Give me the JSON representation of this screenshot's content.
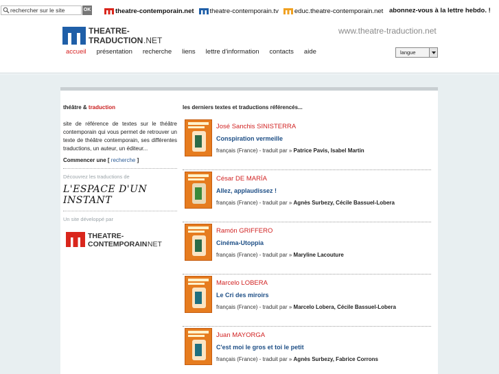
{
  "topbar": {
    "search_placeholder": "rechercher sur le site",
    "ok_label": "OK",
    "links": [
      {
        "label": "theatre-contemporain.net",
        "bold": true
      },
      {
        "label": "theatre-contemporain.tv",
        "bold": false
      },
      {
        "label": "educ.theatre-contemporain.net",
        "bold": false
      }
    ],
    "newsletter": "abonnez-vous à la lettre hebdo. !"
  },
  "header": {
    "logo_line1": "THEATRE-",
    "logo_line2": "TRADUCTION",
    "logo_suffix": ".NET",
    "site_url": "www.theatre-traduction.net",
    "nav": [
      "accueil",
      "présentation",
      "recherche",
      "liens",
      "lettre d'information",
      "contacts",
      "aide"
    ],
    "active_nav": "accueil",
    "lang_label": "langue"
  },
  "left": {
    "heading_part1": "théâtre & ",
    "heading_part2": "traduction",
    "description": "site de référence de textes sur le théâtre contemporain qui vous permet de retrouver un texte de théâtre contemporain, ses différentes traductions, un auteur, un éditeur...",
    "cta_text": "Commencer une [ ",
    "cta_link": "recherche",
    "cta_end": " ]",
    "discover_label": "Découvrez les traductions de",
    "espace_logo": "L'ESPACE D'UN INSTANT",
    "developed_label": "Un site développé par",
    "tc_logo_line1": "THEATRE-",
    "tc_logo_line2": "CONTEMPORAIN",
    "tc_logo_suffix": ".NET"
  },
  "right": {
    "heading": "les derniers textes et traductions référencés...",
    "traduit_par": "traduit par »",
    "entries": [
      {
        "author": "José Sanchis SINISTERRA",
        "title": "Conspiration vermeille",
        "lang": "français (France) -",
        "translators": "Patrice Pavis, Isabel Martin"
      },
      {
        "author": "César DE MARÍA",
        "title": "Allez, applaudissez !",
        "lang": "français (France) -",
        "translators": "Agnès Surbezy, Cécile Bassuel-Lobera"
      },
      {
        "author": "Ramón GRIFFERO",
        "title": "Cinéma-Utoppia",
        "lang": "français (France) -",
        "translators": "Maryline Lacouture"
      },
      {
        "author": "Marcelo LOBERA",
        "title": "Le Cri des miroirs",
        "lang": "français (France) -",
        "translators": "Marcelo Lobera, Cécile Bassuel-Lobera"
      },
      {
        "author": "Juan MAYORGA",
        "title": "C'est moi le gros et toi le petit",
        "lang": "français (France) -",
        "translators": "Agnès Surbezy, Fabrice Corrons"
      }
    ]
  },
  "colors": {
    "accent_red": "#d12222",
    "link_blue": "#1e4f86",
    "logo_blue": "#1f5fa8",
    "logo_red": "#d9261c"
  }
}
